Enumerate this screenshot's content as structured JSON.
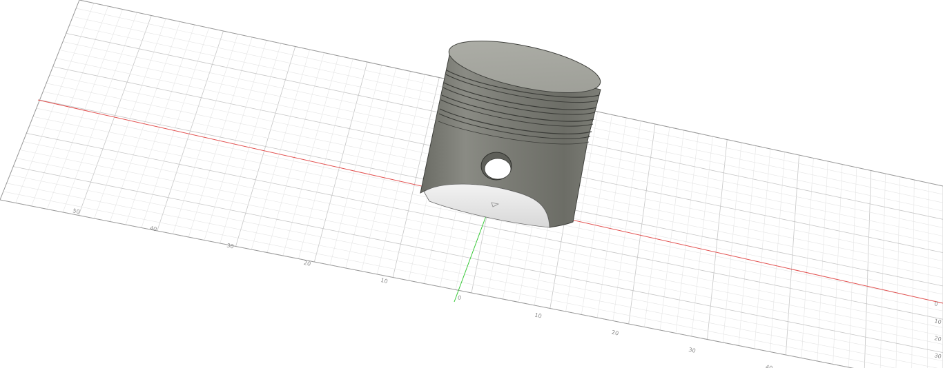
{
  "viewport": {
    "model_name": "piston",
    "background": "#ffffff",
    "grid_minor_color": "#e4e4e4",
    "grid_major_color": "#c6c6c6",
    "grid_border_color": "#9a9a9a",
    "x_axis_color": "#e2504f",
    "y_axis_color": "#37c837",
    "piston_body_color": "#7a7b74",
    "piston_top_color": "#a3a49d"
  },
  "ruler": {
    "front_ticks": [
      "50",
      "40",
      "30",
      "20",
      "10",
      "0",
      "10",
      "20",
      "30",
      "40"
    ],
    "side_ticks": [
      "0",
      "10",
      "20",
      "30"
    ]
  }
}
